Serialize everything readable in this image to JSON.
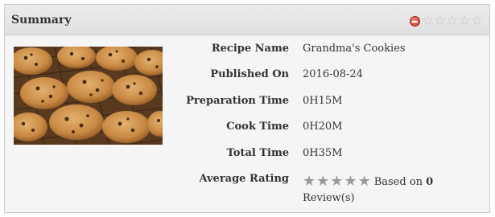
{
  "summary": {
    "title": "Summary",
    "header_rating": {
      "cancel_icon": "cancel-icon",
      "stars": [
        "☆",
        "☆",
        "☆",
        "☆",
        "☆"
      ]
    }
  },
  "image": {
    "icon": "cookie-photo",
    "alt": "Chocolate chip cookies on a cooling rack"
  },
  "details": {
    "recipe_name_label": "Recipe Name",
    "recipe_name_value": "Grandma's Cookies",
    "published_label": "Published On",
    "published_value": "2016-08-24",
    "prep_label": "Preparation Time",
    "prep_value": "0H15M",
    "cook_label": "Cook Time",
    "cook_value": "0H20M",
    "total_label": "Total Time",
    "total_value": "0H35M",
    "rating_label": "Average Rating",
    "rating_stars": [
      "★",
      "★",
      "★",
      "★",
      "★"
    ],
    "based_on_prefix": "Based on",
    "review_count": "0",
    "reviews_suffix": "Review(s)"
  },
  "colors": {
    "header_bg": "#e4e4e4",
    "panel_bg": "#f5f5f5",
    "star_gray": "#9a9a9a",
    "star_empty": "#c4c4c4",
    "cancel_red": "#c9302c"
  }
}
